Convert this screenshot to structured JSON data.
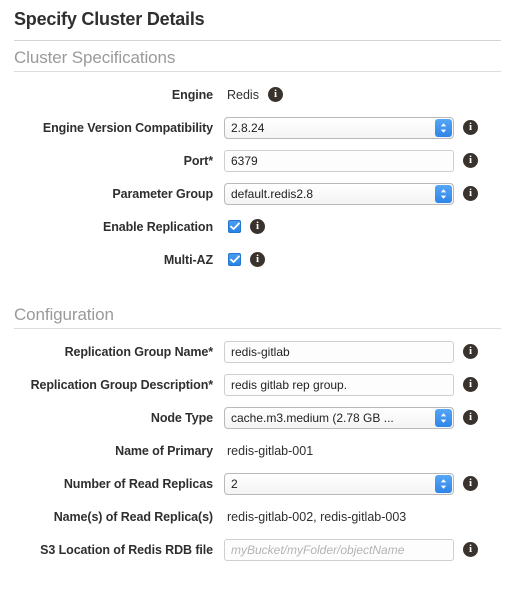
{
  "page": {
    "title": "Specify Cluster Details"
  },
  "icons": {
    "info": "info-icon",
    "check": "check-icon",
    "stepper": "updown-stepper-icon"
  },
  "sections": [
    {
      "legend": "Cluster Specifications",
      "rows": [
        {
          "label": "Engine",
          "type": "static",
          "value": "Redis",
          "info": true
        },
        {
          "label": "Engine Version Compatibility",
          "type": "select",
          "value": "2.8.24",
          "info": true
        },
        {
          "label": "Port*",
          "type": "text",
          "value": "6379",
          "placeholder": "",
          "info": true
        },
        {
          "label": "Parameter Group",
          "type": "select",
          "value": "default.redis2.8",
          "info": true
        },
        {
          "label": "Enable Replication",
          "type": "checkbox",
          "checked": true,
          "info": true
        },
        {
          "label": "Multi-AZ",
          "type": "checkbox",
          "checked": true,
          "info": true
        }
      ]
    },
    {
      "legend": "Configuration",
      "rows": [
        {
          "label": "Replication Group Name*",
          "type": "text",
          "value": "redis-gitlab",
          "placeholder": "",
          "info": true
        },
        {
          "label": "Replication Group Description*",
          "type": "text",
          "value": "redis gitlab rep group.",
          "placeholder": "",
          "info": true
        },
        {
          "label": "Node Type",
          "type": "select",
          "value": "cache.m3.medium (2.78 GB ...",
          "info": true
        },
        {
          "label": "Name of Primary",
          "type": "static",
          "value": "redis-gitlab-001",
          "info": false
        },
        {
          "label": "Number of Read Replicas",
          "type": "select",
          "value": "2",
          "info": true
        },
        {
          "label": "Name(s) of Read Replica(s)",
          "type": "static",
          "value": "redis-gitlab-002, redis-gitlab-003",
          "info": false
        },
        {
          "label": "S3 Location of Redis RDB file",
          "type": "text",
          "value": "",
          "placeholder": "myBucket/myFolder/objectName",
          "info": true
        }
      ]
    }
  ],
  "colors": {
    "accent_blue": "#2f84e8",
    "info_dark": "#3a332d",
    "legend_gray": "#9a9a9a",
    "rule_gray": "#dddddd"
  }
}
